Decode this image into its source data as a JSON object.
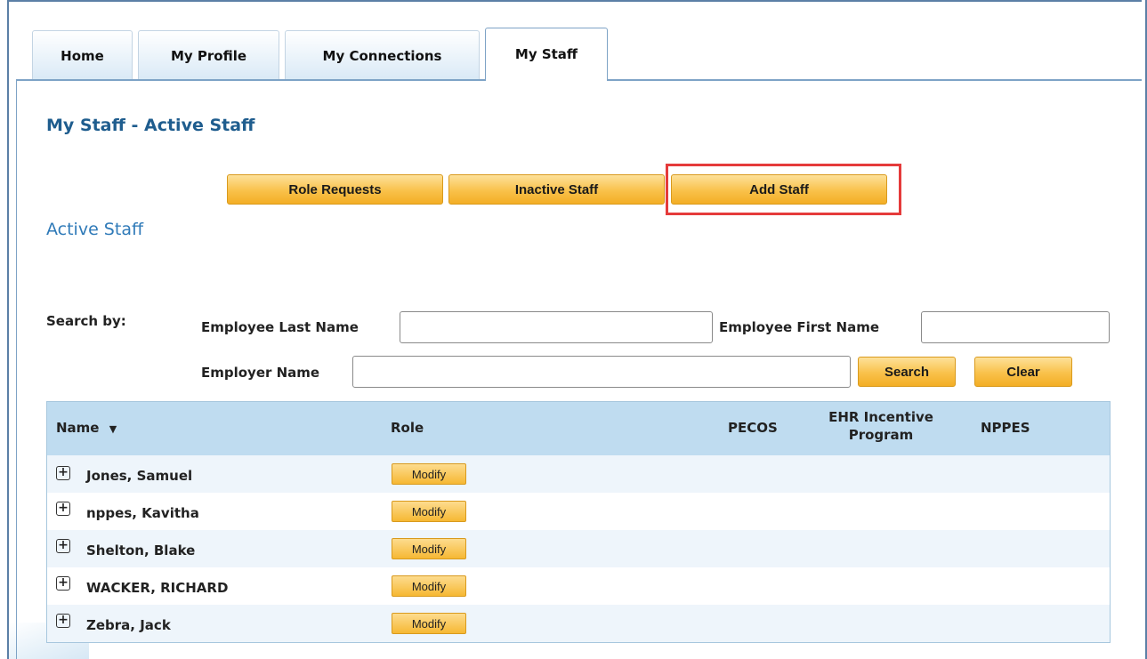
{
  "tabs": [
    {
      "label": "Home"
    },
    {
      "label": "My Profile"
    },
    {
      "label": "My Connections"
    },
    {
      "label": "My Staff",
      "active": true
    }
  ],
  "page_title": "My Staff - Active Staff",
  "action_buttons": {
    "role_requests": "Role Requests",
    "inactive_staff": "Inactive Staff",
    "add_staff": "Add Staff"
  },
  "section_title": "Active Staff",
  "search": {
    "label": "Search by:",
    "last_name_label": "Employee Last Name",
    "last_name_value": "",
    "first_name_label": "Employee First Name",
    "first_name_value": "",
    "employer_label": "Employer Name",
    "employer_value": "",
    "search_button": "Search",
    "clear_button": "Clear"
  },
  "table": {
    "headers": {
      "name": "Name",
      "role": "Role",
      "pecos": "PECOS",
      "ehr_line1": "EHR Incentive",
      "ehr_line2": "Program",
      "nppes": "NPPES"
    },
    "sort_icon": "caret-down-icon",
    "modify_label": "Modify",
    "rows": [
      {
        "name": "Jones, Samuel"
      },
      {
        "name": "nppes, Kavitha"
      },
      {
        "name": "Shelton, Blake"
      },
      {
        "name": "WACKER, RICHARD"
      },
      {
        "name": "Zebra, Jack"
      }
    ]
  },
  "colors": {
    "border_blue": "#5b7fa6",
    "title_blue": "#1f5d8e",
    "header_bg": "#bfdcf0",
    "button_gold": "#f9c14a",
    "highlight_red": "#e53b3b"
  }
}
